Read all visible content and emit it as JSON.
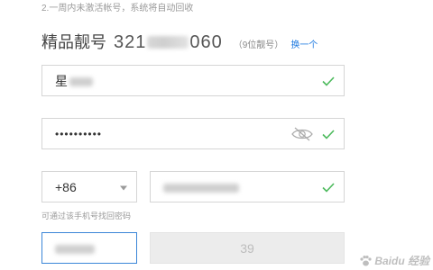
{
  "hints": {
    "inactive_notice": "2.一周内未激活帐号，系统将自动回收",
    "phone_hint": "可通过该手机号找回密码"
  },
  "account": {
    "label": "精品靓号",
    "number_prefix": "321",
    "number_suffix": "060",
    "tag": "（9位靓号）",
    "change_link": "换一个"
  },
  "form": {
    "nickname_value": "星",
    "password_value": "••••••••••",
    "country_code": "+86",
    "sms_button_label": "39"
  },
  "colors": {
    "accent": "#1e7ae0",
    "valid_check": "#4cba5c",
    "focus_border": "#3b86d8"
  },
  "watermark": {
    "text": "Baidu 经验"
  }
}
